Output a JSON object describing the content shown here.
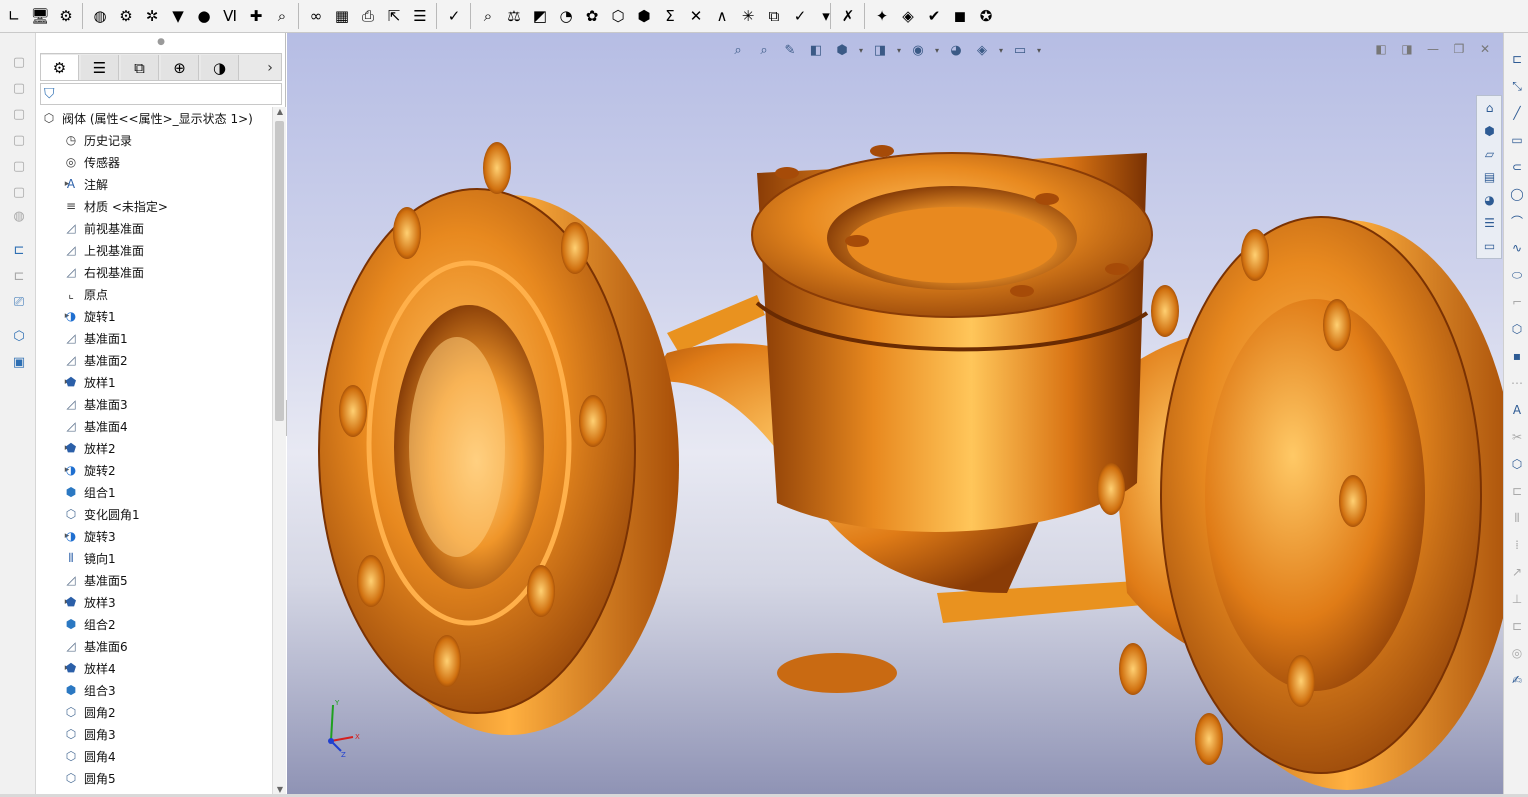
{
  "colors": {
    "accent": "#2e6fb3",
    "model_copper": "#e8891f",
    "model_highlight": "#ffc65a",
    "model_shadow": "#8a3c06",
    "viewport_top": "#b6bde4",
    "viewport_bottom": "#8e92b4"
  },
  "top_toolbar": {
    "buttons": [
      {
        "icon": "sketch-icon",
        "glyph": "∟"
      },
      {
        "icon": "monitor-icon",
        "glyph": "🖥"
      },
      {
        "icon": "assembly-icon",
        "glyph": "⚙"
      },
      {
        "icon": "globe-icon",
        "glyph": "◍"
      },
      {
        "icon": "gear-icon",
        "glyph": "⚙"
      },
      {
        "icon": "settings-icon",
        "glyph": "✲"
      },
      {
        "icon": "hopper-icon",
        "glyph": "▼"
      },
      {
        "icon": "location-pin-icon",
        "glyph": "●"
      },
      {
        "icon": "spring-icon",
        "glyph": "Ⅵ"
      },
      {
        "icon": "cross-icon",
        "glyph": "✚"
      },
      {
        "icon": "magnifier-icon",
        "glyph": "⌕"
      },
      {
        "icon": "binoculars-icon",
        "glyph": "∞"
      },
      {
        "icon": "excel-icon",
        "glyph": "▦"
      },
      {
        "icon": "print-icon",
        "glyph": "⎙"
      },
      {
        "icon": "export-icon",
        "glyph": "⇱"
      },
      {
        "icon": "report-icon",
        "glyph": "☰"
      },
      {
        "icon": "spell-check-icon",
        "glyph": "✓"
      },
      {
        "icon": "measure-icon",
        "glyph": "⌕"
      },
      {
        "icon": "mass-properties-icon",
        "glyph": "⚖"
      },
      {
        "icon": "section-icon",
        "glyph": "◩"
      },
      {
        "icon": "gauge-icon",
        "glyph": "◔"
      },
      {
        "icon": "check-icon",
        "glyph": "✿"
      },
      {
        "icon": "geometry-icon",
        "glyph": "⬡"
      },
      {
        "icon": "cube-icon",
        "glyph": "⬢"
      },
      {
        "icon": "sum-icon",
        "glyph": "Σ"
      },
      {
        "icon": "compare-icon",
        "glyph": "✕"
      },
      {
        "icon": "draft-analysis-icon",
        "glyph": "∧"
      },
      {
        "icon": "symmetry-icon",
        "glyph": "✳"
      },
      {
        "icon": "copy-icon",
        "glyph": "⧉"
      },
      {
        "icon": "interference-icon",
        "glyph": "✓"
      },
      {
        "icon": "dropdown-icon",
        "glyph": "▾"
      },
      {
        "icon": "table-check-icon",
        "glyph": "✗"
      },
      {
        "icon": "addin-icon",
        "glyph": "✦"
      },
      {
        "icon": "render-icon",
        "glyph": "◈"
      },
      {
        "icon": "approve-icon",
        "glyph": "✔"
      },
      {
        "icon": "pdm-icon",
        "glyph": "◼"
      },
      {
        "icon": "web-icon",
        "glyph": "✪"
      }
    ]
  },
  "left_strip": {
    "buttons": [
      {
        "icon": "box-icon",
        "glyph": "▢"
      },
      {
        "icon": "box-outline-icon",
        "glyph": "▢"
      },
      {
        "icon": "box-hidden-icon",
        "glyph": "▢"
      },
      {
        "icon": "box-shaded-icon",
        "glyph": "▢"
      },
      {
        "icon": "box-edges-icon",
        "glyph": "▢"
      },
      {
        "icon": "box-section-icon",
        "glyph": "▢"
      },
      {
        "icon": "box-render-icon",
        "glyph": "◍"
      },
      {
        "icon": "rect-sketch-icon",
        "glyph": "⊏"
      },
      {
        "icon": "rect-outline-icon",
        "glyph": "⊏"
      },
      {
        "icon": "monitor-small-icon",
        "glyph": "⎚"
      },
      {
        "icon": "part-icon",
        "glyph": "⬡"
      },
      {
        "icon": "drawing-icon",
        "glyph": "▣"
      }
    ]
  },
  "feature_panel": {
    "tabs": [
      {
        "icon": "featuremanager-icon",
        "glyph": "⚙"
      },
      {
        "icon": "propertymanager-icon",
        "glyph": "☰"
      },
      {
        "icon": "configurationmanager-icon",
        "glyph": "⧉"
      },
      {
        "icon": "dimxpert-icon",
        "glyph": "⊕"
      },
      {
        "icon": "display-manager-icon",
        "glyph": "◑"
      }
    ],
    "more_glyph": "›",
    "filter_glyph": "⛉",
    "tree": [
      {
        "label": "阀体 (属性<<属性>_显示状态 1>)",
        "icon": "part-icon",
        "glyph": "⬡",
        "cls": "ic-misc",
        "expand": "",
        "level": 0
      },
      {
        "label": "历史记录",
        "icon": "history-icon",
        "glyph": "◷",
        "cls": "ic-misc",
        "expand": "",
        "level": 1
      },
      {
        "label": "传感器",
        "icon": "sensor-icon",
        "glyph": "◎",
        "cls": "ic-misc",
        "expand": "",
        "level": 1
      },
      {
        "label": "注解",
        "icon": "annotation-icon",
        "glyph": "A",
        "cls": "ic-loft",
        "expand": "▸",
        "level": 1
      },
      {
        "label": "材质 <未指定>",
        "icon": "material-icon",
        "glyph": "≡",
        "cls": "ic-misc",
        "expand": "",
        "level": 1
      },
      {
        "label": "前视基准面",
        "icon": "plane-icon",
        "glyph": "◿",
        "cls": "ic-plane",
        "expand": "",
        "level": 1
      },
      {
        "label": "上视基准面",
        "icon": "plane-icon",
        "glyph": "◿",
        "cls": "ic-plane",
        "expand": "",
        "level": 1
      },
      {
        "label": "右视基准面",
        "icon": "plane-icon",
        "glyph": "◿",
        "cls": "ic-plane",
        "expand": "",
        "level": 1
      },
      {
        "label": "原点",
        "icon": "origin-icon",
        "glyph": "⌞",
        "cls": "ic-misc",
        "expand": "",
        "level": 1
      },
      {
        "label": "旋转1",
        "icon": "revolve-icon",
        "glyph": "◑",
        "cls": "ic-revolve",
        "expand": "▸",
        "level": 1
      },
      {
        "label": "基准面1",
        "icon": "plane-icon",
        "glyph": "◿",
        "cls": "ic-plane",
        "expand": "",
        "level": 1
      },
      {
        "label": "基准面2",
        "icon": "plane-icon",
        "glyph": "◿",
        "cls": "ic-plane",
        "expand": "",
        "level": 1
      },
      {
        "label": "放样1",
        "icon": "loft-icon",
        "glyph": "⬟",
        "cls": "ic-loft",
        "expand": "▸",
        "level": 1
      },
      {
        "label": "基准面3",
        "icon": "plane-icon",
        "glyph": "◿",
        "cls": "ic-plane",
        "expand": "",
        "level": 1
      },
      {
        "label": "基准面4",
        "icon": "plane-icon",
        "glyph": "◿",
        "cls": "ic-plane",
        "expand": "",
        "level": 1
      },
      {
        "label": "放样2",
        "icon": "loft-icon",
        "glyph": "⬟",
        "cls": "ic-loft",
        "expand": "▸",
        "level": 1
      },
      {
        "label": "旋转2",
        "icon": "revolve-icon",
        "glyph": "◑",
        "cls": "ic-revolve",
        "expand": "▸",
        "level": 1
      },
      {
        "label": "组合1",
        "icon": "combine-icon",
        "glyph": "⬢",
        "cls": "ic-combine",
        "expand": "",
        "level": 1
      },
      {
        "label": "变化圆角1",
        "icon": "variable-fillet-icon",
        "glyph": "⬡",
        "cls": "ic-fillet",
        "expand": "",
        "level": 1
      },
      {
        "label": "旋转3",
        "icon": "revolve-icon",
        "glyph": "◑",
        "cls": "ic-revolve",
        "expand": "▸",
        "level": 1
      },
      {
        "label": "镜向1",
        "icon": "mirror-icon",
        "glyph": "⫴",
        "cls": "ic-loft",
        "expand": "",
        "level": 1
      },
      {
        "label": "基准面5",
        "icon": "plane-icon",
        "glyph": "◿",
        "cls": "ic-plane",
        "expand": "",
        "level": 1
      },
      {
        "label": "放样3",
        "icon": "loft-icon",
        "glyph": "⬟",
        "cls": "ic-loft",
        "expand": "▸",
        "level": 1
      },
      {
        "label": "组合2",
        "icon": "combine-icon",
        "glyph": "⬢",
        "cls": "ic-combine",
        "expand": "",
        "level": 1
      },
      {
        "label": "基准面6",
        "icon": "plane-icon",
        "glyph": "◿",
        "cls": "ic-plane",
        "expand": "",
        "level": 1
      },
      {
        "label": "放样4",
        "icon": "loft-icon",
        "glyph": "⬟",
        "cls": "ic-loft",
        "expand": "▸",
        "level": 1
      },
      {
        "label": "组合3",
        "icon": "combine-icon",
        "glyph": "⬢",
        "cls": "ic-combine",
        "expand": "",
        "level": 1
      },
      {
        "label": "圆角2",
        "icon": "fillet-icon",
        "glyph": "⬡",
        "cls": "ic-fillet",
        "expand": "",
        "level": 1
      },
      {
        "label": "圆角3",
        "icon": "fillet-icon",
        "glyph": "⬡",
        "cls": "ic-fillet",
        "expand": "",
        "level": 1
      },
      {
        "label": "圆角4",
        "icon": "fillet-icon",
        "glyph": "⬡",
        "cls": "ic-fillet",
        "expand": "",
        "level": 1
      },
      {
        "label": "圆角5",
        "icon": "fillet-icon",
        "glyph": "⬡",
        "cls": "ic-fillet",
        "expand": "",
        "level": 1
      }
    ]
  },
  "heads_up": {
    "buttons": [
      {
        "icon": "zoom-to-fit-icon",
        "glyph": "⌕",
        "caret": false
      },
      {
        "icon": "zoom-to-area-icon",
        "glyph": "⌕",
        "caret": false
      },
      {
        "icon": "previous-view-icon",
        "glyph": "✎",
        "caret": false
      },
      {
        "icon": "section-view-icon",
        "glyph": "◧",
        "caret": false
      },
      {
        "icon": "view-orientation-icon",
        "glyph": "⬢",
        "caret": true
      },
      {
        "icon": "display-style-icon",
        "glyph": "◨",
        "caret": true
      },
      {
        "icon": "hide-show-icon",
        "glyph": "◉",
        "caret": true
      },
      {
        "icon": "edit-appearance-icon",
        "glyph": "◕",
        "caret": false
      },
      {
        "icon": "scene-icon",
        "glyph": "◈",
        "caret": true
      },
      {
        "icon": "view-settings-icon",
        "glyph": "▭",
        "caret": true
      }
    ]
  },
  "window_controls": [
    {
      "icon": "panel-left-icon",
      "glyph": "◧"
    },
    {
      "icon": "panel-right-icon",
      "glyph": "◨"
    },
    {
      "icon": "minimize-icon",
      "glyph": "—"
    },
    {
      "icon": "restore-icon",
      "glyph": "❐"
    },
    {
      "icon": "close-icon",
      "glyph": "✕"
    }
  ],
  "view_palette": {
    "buttons": [
      {
        "icon": "home-icon",
        "glyph": "⌂"
      },
      {
        "icon": "3d-library-icon",
        "glyph": "⬢"
      },
      {
        "icon": "file-explorer-icon",
        "glyph": "▱"
      },
      {
        "icon": "view-palette-icon",
        "glyph": "▤"
      },
      {
        "icon": "appearances-icon",
        "glyph": "◕"
      },
      {
        "icon": "custom-properties-icon",
        "glyph": "☰"
      },
      {
        "icon": "forum-icon",
        "glyph": "▭"
      }
    ]
  },
  "right_strip": {
    "buttons": [
      {
        "icon": "sketch-rect-icon",
        "glyph": "⊏",
        "dim": false
      },
      {
        "icon": "smart-dim-icon",
        "glyph": "⤡",
        "dim": false
      },
      {
        "icon": "line-icon",
        "glyph": "╱",
        "dim": false
      },
      {
        "icon": "rectangle-icon",
        "glyph": "▭",
        "dim": false
      },
      {
        "icon": "slot-icon",
        "glyph": "⊂",
        "dim": false
      },
      {
        "icon": "circle-icon",
        "glyph": "◯",
        "dim": false
      },
      {
        "icon": "arc-icon",
        "glyph": "⌒",
        "dim": false
      },
      {
        "icon": "spline-icon",
        "glyph": "∿",
        "dim": false
      },
      {
        "icon": "ellipse-icon",
        "glyph": "⬭",
        "dim": false
      },
      {
        "icon": "fillet-sketch-icon",
        "glyph": "⌐",
        "dim": true
      },
      {
        "icon": "polygon-icon",
        "glyph": "⬡",
        "dim": false
      },
      {
        "icon": "point-icon",
        "glyph": "▪",
        "dim": false
      },
      {
        "icon": "centerline-icon",
        "glyph": "⋯",
        "dim": true
      },
      {
        "icon": "text-icon",
        "glyph": "A",
        "dim": false
      },
      {
        "icon": "trim-icon",
        "glyph": "✂",
        "dim": true
      },
      {
        "icon": "convert-icon",
        "glyph": "⬡",
        "dim": false
      },
      {
        "icon": "offset-icon",
        "glyph": "⊏",
        "dim": true
      },
      {
        "icon": "mirror-sketch-icon",
        "glyph": "⫴",
        "dim": true
      },
      {
        "icon": "pattern-icon",
        "glyph": "⁞",
        "dim": true
      },
      {
        "icon": "move-icon",
        "glyph": "↗",
        "dim": true
      },
      {
        "icon": "relation-icon",
        "glyph": "⊥",
        "dim": true
      },
      {
        "icon": "repair-icon",
        "glyph": "⊏",
        "dim": true
      },
      {
        "icon": "quick-snap-icon",
        "glyph": "◎",
        "dim": true
      },
      {
        "icon": "rapid-sketch-icon",
        "glyph": "✍",
        "dim": false
      }
    ]
  }
}
